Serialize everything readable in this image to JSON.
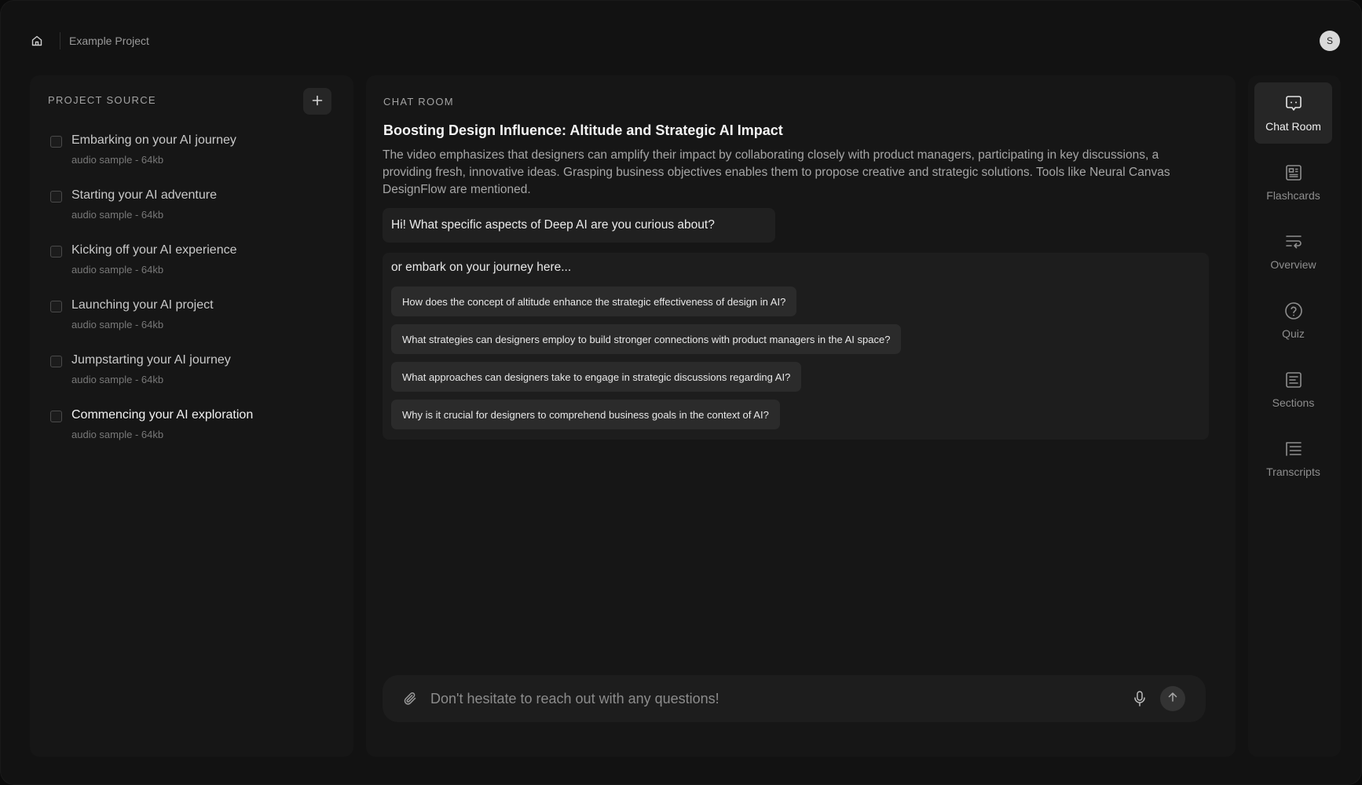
{
  "header": {
    "breadcrumb": "Example Project",
    "avatar_initial": "S",
    "home_icon": "home-icon"
  },
  "sidebar": {
    "title": "PROJECT SOURCE",
    "add_icon": "plus-icon",
    "items": [
      {
        "title": "Embarking on your AI journey",
        "meta": "audio sample - 64kb",
        "checked": false,
        "active": false
      },
      {
        "title": "Starting your AI adventure",
        "meta": "audio sample - 64kb",
        "checked": false,
        "active": false
      },
      {
        "title": "Kicking off your AI experience",
        "meta": "audio sample - 64kb",
        "checked": false,
        "active": false
      },
      {
        "title": "Launching your AI project",
        "meta": "audio sample - 64kb",
        "checked": false,
        "active": false
      },
      {
        "title": "Jumpstarting your AI journey",
        "meta": "audio sample - 64kb",
        "checked": false,
        "active": false
      },
      {
        "title": "Commencing your AI exploration",
        "meta": "audio sample - 64kb",
        "checked": false,
        "active": true
      }
    ]
  },
  "chat": {
    "label": "CHAT ROOM",
    "title": "Boosting Design Influence: Altitude and Strategic AI Impact",
    "summary_lines": [
      "The video emphasizes that designers can amplify their impact by collaborating closely with product managers, participating in key discussions, a",
      "providing fresh, innovative ideas. Grasping business objectives enables them to propose creative and strategic solutions. Tools like Neural Canvas",
      "DesignFlow are mentioned."
    ],
    "bot_message": "Hi! What specific aspects of Deep AI are you curious about?",
    "suggest_intro": "or embark on your journey here...",
    "suggestions": [
      "How does the concept of altitude enhance the strategic effectiveness of design in AI?",
      "What strategies can designers employ to build stronger connections with product managers in the AI space?",
      "What approaches can designers take to engage in strategic discussions regarding AI?",
      "Why is it crucial for designers to comprehend business goals in the context of AI?"
    ],
    "composer": {
      "placeholder": "Don't hesitate to reach out with any questions!",
      "value": "",
      "attach_icon": "paperclip-icon",
      "mic_icon": "microphone-icon",
      "send_icon": "arrow-up-icon"
    }
  },
  "rail": {
    "items": [
      {
        "label": "Chat Room",
        "icon": "chat-icon",
        "active": true
      },
      {
        "label": "Flashcards",
        "icon": "flashcards-icon",
        "active": false
      },
      {
        "label": "Overview",
        "icon": "overview-icon",
        "active": false
      },
      {
        "label": "Quiz",
        "icon": "quiz-icon",
        "active": false
      },
      {
        "label": "Sections",
        "icon": "sections-icon",
        "active": false
      },
      {
        "label": "Transcripts",
        "icon": "transcripts-icon",
        "active": false
      }
    ]
  }
}
